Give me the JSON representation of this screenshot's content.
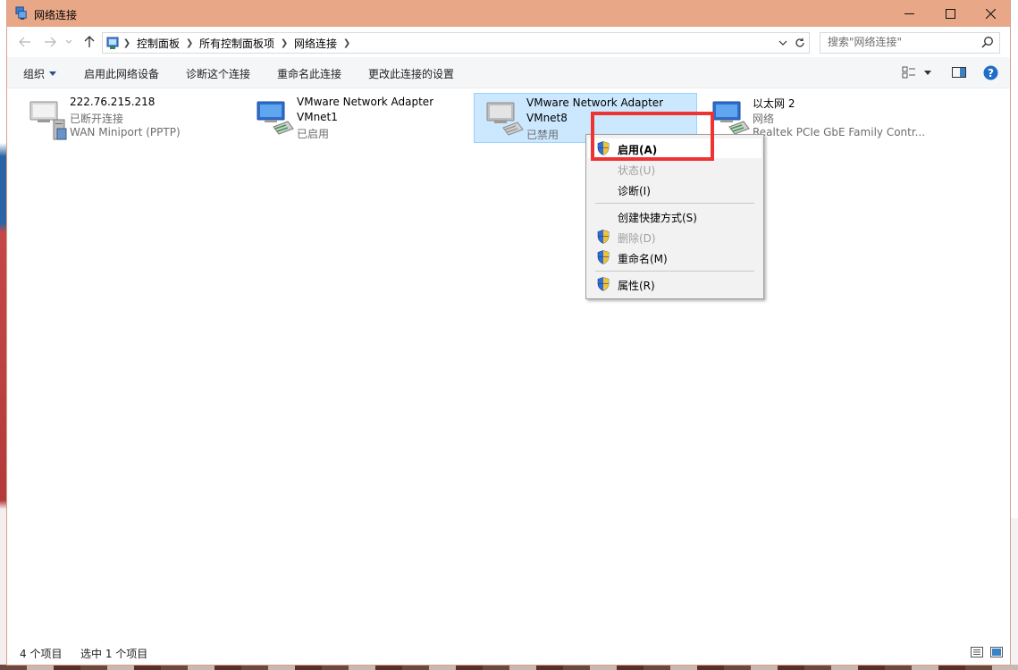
{
  "window": {
    "title": "网络连接"
  },
  "address": {
    "breadcrumbs": [
      "控制面板",
      "所有控制面板项",
      "网络连接"
    ],
    "search_placeholder": "搜索\"网络连接\""
  },
  "toolbar": {
    "organize": "组织",
    "enable": "启用此网络设备",
    "diagnose": "诊断这个连接",
    "rename": "重命名此连接",
    "change_settings": "更改此连接的设置"
  },
  "connections": [
    {
      "name": "222.76.215.218",
      "status": "已断开连接",
      "device": "WAN Miniport (PPTP)"
    },
    {
      "name": "VMware Network Adapter",
      "name2": "VMnet1",
      "status": "已启用"
    },
    {
      "name": "VMware Network Adapter",
      "name2": "VMnet8",
      "status": "已禁用"
    },
    {
      "name": "以太网 2",
      "status": "网络",
      "device": "Realtek PCIe GbE Family Contr..."
    }
  ],
  "context_menu": {
    "items": [
      {
        "label": "启用(A)"
      },
      {
        "label": "状态(U)"
      },
      {
        "label": "诊断(I)"
      },
      {
        "label": "创建快捷方式(S)"
      },
      {
        "label": "删除(D)"
      },
      {
        "label": "重命名(M)"
      },
      {
        "label": "属性(R)"
      }
    ]
  },
  "status": {
    "count": "4 个项目",
    "selected": "选中 1 个项目"
  },
  "colors": {
    "titlebar": "#e8a888",
    "selection": "#cce8ff",
    "highlight_box": "#ee3333"
  }
}
